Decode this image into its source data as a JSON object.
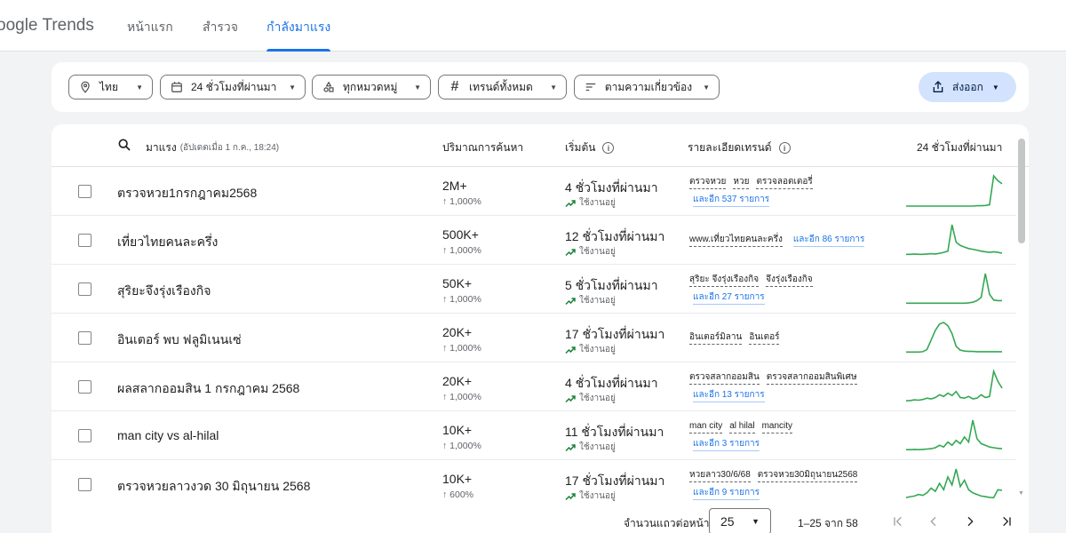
{
  "header": {
    "logo_text": "oogle",
    "logo_suffix": "Trends",
    "tabs": [
      {
        "label": "หน้าแรก"
      },
      {
        "label": "สำรวจ"
      },
      {
        "label": "กำลังมาแรง"
      }
    ]
  },
  "filters": {
    "region": "ไทย",
    "time": "24 ชั่วโมงที่ผ่านมา",
    "category": "ทุกหมวดหมู่",
    "trend_type": "เทรนด์ทั้งหมด",
    "sort": "ตามความเกี่ยวข้อง",
    "export_label": "ส่งออก"
  },
  "table": {
    "col_trending": "มาแรง",
    "col_trending_sub": "(อัปเดตเมื่อ 1 ก.ค., 18:24)",
    "col_volume": "ปริมาณการค้นหา",
    "col_started": "เริ่มต้น",
    "col_breakdown": "รายละเอียดเทรนด์",
    "col_chart": "24 ชั่วโมงที่ผ่านมา",
    "rows": [
      {
        "term": "ตรวจหวย1กรกฎาคม2568",
        "volume": "2M+",
        "pct": "↑ 1,000%",
        "started": "4 ชั่วโมงที่ผ่านมา",
        "status": "ใช้งานอยู่",
        "tags": [
          "ตรวจหวย",
          "หวย",
          "ตรวจลอตเตอรี่"
        ],
        "more": "และอีก 537 รายการ",
        "spark": [
          0,
          0,
          0,
          0,
          0,
          0,
          0,
          0,
          0,
          0,
          0,
          0,
          0,
          0,
          0,
          0,
          0,
          1,
          1,
          2,
          4,
          95,
          80,
          70
        ]
      },
      {
        "term": "เที่ยวไทยคนละครึ่ง",
        "volume": "500K+",
        "pct": "↑ 1,000%",
        "started": "12 ชั่วโมงที่ผ่านมา",
        "status": "ใช้งานอยู่",
        "tags": [
          "www.เที่ยวไทยคนละครึ่ง"
        ],
        "more": "และอีก 86 รายการ",
        "spark": [
          2,
          2,
          3,
          2,
          2,
          3,
          4,
          3,
          5,
          8,
          12,
          95,
          40,
          30,
          25,
          20,
          18,
          15,
          12,
          10,
          8,
          10,
          8,
          6
        ]
      },
      {
        "term": "สุริยะจึงรุ่งเรืองกิจ",
        "volume": "50K+",
        "pct": "↑ 1,000%",
        "started": "5 ชั่วโมงที่ผ่านมา",
        "status": "ใช้งานอยู่",
        "tags": [
          "สุริยะ จึงรุ่งเรืองกิจ",
          "จึงรุ่งเรืองกิจ"
        ],
        "more": "และอีก 27 รายการ",
        "spark": [
          2,
          2,
          2,
          2,
          2,
          2,
          2,
          2,
          2,
          2,
          2,
          2,
          2,
          2,
          2,
          3,
          5,
          10,
          20,
          95,
          30,
          12,
          10,
          10
        ]
      },
      {
        "term": "อินเตอร์ พบ ฟลูมิเนนเซ่",
        "volume": "20K+",
        "pct": "↑ 1,000%",
        "started": "17 ชั่วโมงที่ผ่านมา",
        "status": "ใช้งานอยู่",
        "tags": [
          "อินเตอร์มิลาน",
          "อินเตอร์"
        ],
        "more": "",
        "spark": [
          2,
          2,
          2,
          2,
          3,
          10,
          40,
          70,
          90,
          95,
          85,
          60,
          20,
          8,
          5,
          4,
          4,
          3,
          3,
          3,
          3,
          3,
          3,
          3
        ]
      },
      {
        "term": "ผลสลากออมสิน 1 กรกฎาคม 2568",
        "volume": "20K+",
        "pct": "↑ 1,000%",
        "started": "4 ชั่วโมงที่ผ่านมา",
        "status": "ใช้งานอยู่",
        "tags": [
          "ตรวจสลากออมสิน",
          "ตรวจสลากออมสินพิเศษ"
        ],
        "more": "และอีก 13 รายการ",
        "spark": [
          2,
          3,
          5,
          4,
          6,
          10,
          8,
          12,
          20,
          15,
          25,
          18,
          30,
          12,
          10,
          15,
          8,
          10,
          20,
          12,
          15,
          90,
          60,
          40
        ]
      },
      {
        "term": "man city vs al-hilal",
        "volume": "10K+",
        "pct": "↑ 1,000%",
        "started": "11 ชั่วโมงที่ผ่านมา",
        "status": "ใช้งานอยู่",
        "tags": [
          "man city",
          "al hilal",
          "mancity"
        ],
        "more": "และอีก 3 รายการ",
        "spark": [
          2,
          2,
          3,
          2,
          3,
          4,
          5,
          8,
          15,
          10,
          25,
          15,
          30,
          20,
          40,
          25,
          90,
          35,
          20,
          15,
          10,
          8,
          6,
          5
        ]
      },
      {
        "term": "ตรวจหวยลาวงวด 30 มิถุนายน 2568",
        "volume": "10K+",
        "pct": "↑ 600%",
        "started": "17 ชั่วโมงที่ผ่านมา",
        "status": "ใช้งานอยู่",
        "tags": [
          "หวยลาว30/6/68",
          "ตรวจหวย30มิถุนายน2568"
        ],
        "more": "และอีก 9 รายการ",
        "spark": [
          5,
          8,
          10,
          15,
          12,
          20,
          35,
          25,
          50,
          30,
          70,
          45,
          95,
          40,
          60,
          30,
          20,
          15,
          10,
          8,
          6,
          5,
          30,
          28
        ]
      }
    ]
  },
  "pagination": {
    "rows_label": "จำนวนแถวต่อหน้า",
    "rows_value": "25",
    "range": "1–25 จาก 58"
  },
  "colors": {
    "accent": "#1a73e8",
    "spark": "#34a853"
  }
}
